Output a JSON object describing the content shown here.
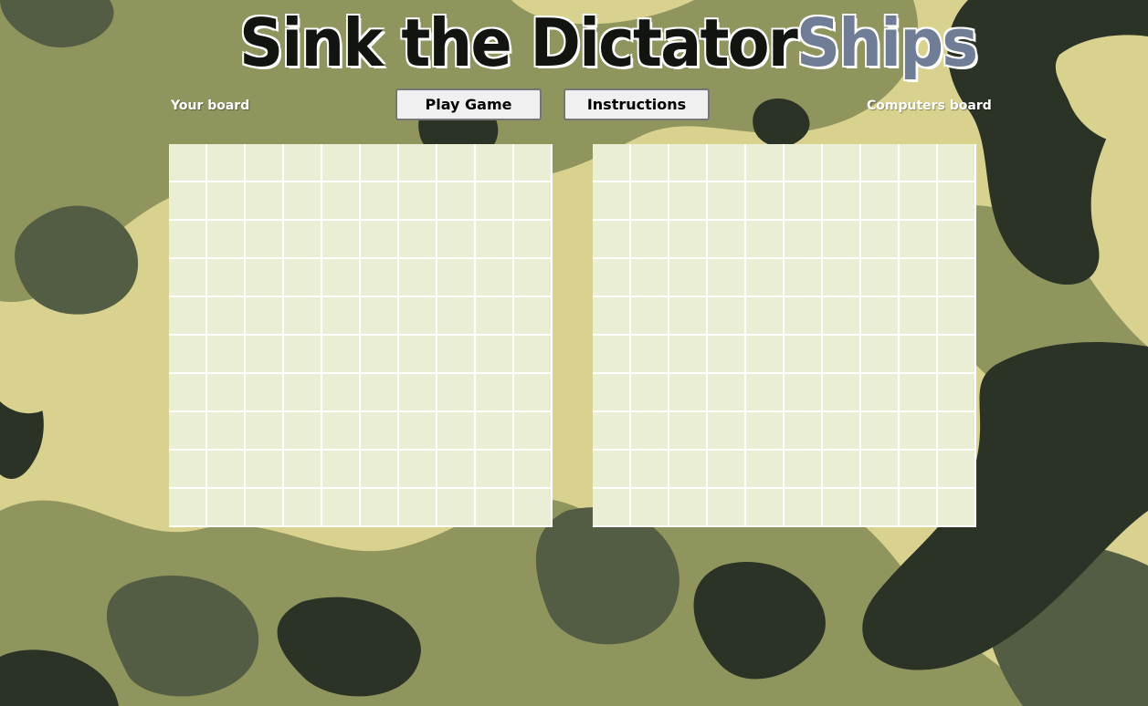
{
  "title": {
    "main": "Sink the Dictator",
    "accent": "Ships"
  },
  "labels": {
    "player_board": "Your board",
    "computer_board": "Computers board"
  },
  "buttons": {
    "play": "Play Game",
    "instructions": "Instructions"
  },
  "boards": {
    "rows": 10,
    "cols": 10
  },
  "colors": {
    "camo_light": "#d8d28e",
    "camo_mid": "#8f955d",
    "camo_dark": "#535d43",
    "camo_darkest": "#2a3326",
    "cell": "#e9eed5",
    "title_accent": "#6f7d96"
  }
}
